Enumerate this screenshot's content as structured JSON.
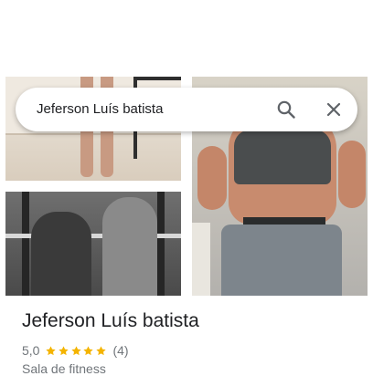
{
  "search": {
    "query": "Jeferson Luís batista"
  },
  "place": {
    "name": "Jeferson Luís batista",
    "rating": "5,0",
    "stars": 5,
    "review_count": "(4)",
    "category": "Sala de fitness"
  },
  "colors": {
    "star": "#f4b400",
    "title_text": "#202124",
    "secondary_text": "#70757a"
  },
  "photos": [
    {
      "description": "legs"
    },
    {
      "description": "gym"
    },
    {
      "description": "abs"
    }
  ]
}
